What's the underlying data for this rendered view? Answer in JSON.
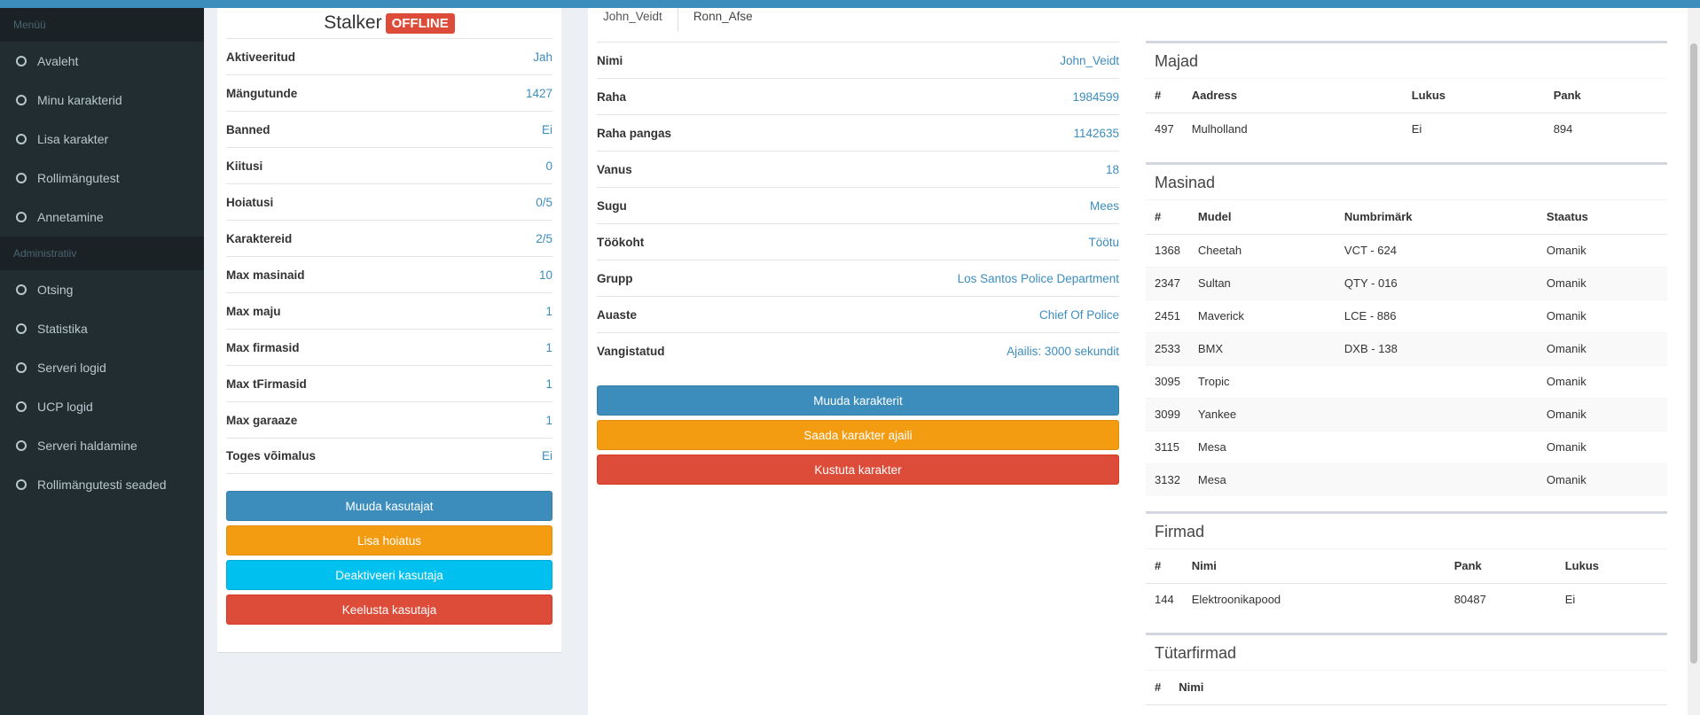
{
  "sidebar": {
    "header1": "Menüü",
    "items1": [
      {
        "label": "Avaleht"
      },
      {
        "label": "Minu karakterid"
      },
      {
        "label": "Lisa karakter"
      },
      {
        "label": "Rollimängutest"
      },
      {
        "label": "Annetamine"
      }
    ],
    "header2": "Administratiiv",
    "items2": [
      {
        "label": "Otsing"
      },
      {
        "label": "Statistika"
      },
      {
        "label": "Serveri logid"
      },
      {
        "label": "UCP logid"
      },
      {
        "label": "Serveri haldamine"
      },
      {
        "label": "Rollimängutesti seaded"
      }
    ]
  },
  "user": {
    "name": "Stalker",
    "status": "OFFLINE",
    "status_color": "#dd4b39",
    "fields": [
      {
        "label": "Aktiveeritud",
        "value": "Jah"
      },
      {
        "label": "Mängutunde",
        "value": "1427"
      },
      {
        "label": "Banned",
        "value": "Ei"
      },
      {
        "label": "Kiitusi",
        "value": "0"
      },
      {
        "label": "Hoiatusi",
        "value": "0/5"
      },
      {
        "label": "Karaktereid",
        "value": "2/5"
      },
      {
        "label": "Max masinaid",
        "value": "10"
      },
      {
        "label": "Max maju",
        "value": "1"
      },
      {
        "label": "Max firmasid",
        "value": "1"
      },
      {
        "label": "Max tFirmasid",
        "value": "1"
      },
      {
        "label": "Max garaaze",
        "value": "1"
      },
      {
        "label": "Toges võimalus",
        "value": "Ei"
      }
    ],
    "buttons": {
      "edit": "Muuda kasutajat",
      "warn": "Lisa hoiatus",
      "deactivate": "Deaktiveeri kasutaja",
      "ban": "Keelusta kasutaja"
    }
  },
  "character": {
    "tabs": [
      "John_Veidt",
      "Ronn_Afse"
    ],
    "fields": [
      {
        "label": "Nimi",
        "value": "John_Veidt"
      },
      {
        "label": "Raha",
        "value": "1984599"
      },
      {
        "label": "Raha pangas",
        "value": "1142635"
      },
      {
        "label": "Vanus",
        "value": "18"
      },
      {
        "label": "Sugu",
        "value": "Mees"
      },
      {
        "label": "Töökoht",
        "value": "Töötu"
      },
      {
        "label": "Grupp",
        "value": "Los Santos Police Department"
      },
      {
        "label": "Auaste",
        "value": "Chief Of Police"
      },
      {
        "label": "Vangistatud",
        "value": "Ajailis: 3000 sekundit"
      }
    ],
    "buttons": {
      "edit": "Muuda karakterit",
      "jail": "Saada karakter ajaili",
      "delete": "Kustuta karakter"
    }
  },
  "houses": {
    "title": "Majad",
    "headers": [
      "#",
      "Aadress",
      "Lukus",
      "Pank"
    ],
    "rows": [
      [
        "497",
        "Mulholland",
        "Ei",
        "894"
      ]
    ]
  },
  "vehicles": {
    "title": "Masinad",
    "headers": [
      "#",
      "Mudel",
      "Numbrimärk",
      "Staatus"
    ],
    "rows": [
      [
        "1368",
        "Cheetah",
        "VCT - 624",
        "Omanik"
      ],
      [
        "2347",
        "Sultan",
        "QTY - 016",
        "Omanik"
      ],
      [
        "2451",
        "Maverick",
        "LCE - 886",
        "Omanik"
      ],
      [
        "2533",
        "BMX",
        "DXB - 138",
        "Omanik"
      ],
      [
        "3095",
        "Tropic",
        "",
        "Omanik"
      ],
      [
        "3099",
        "Yankee",
        "",
        "Omanik"
      ],
      [
        "3115",
        "Mesa",
        "",
        "Omanik"
      ],
      [
        "3132",
        "Mesa",
        "",
        "Omanik"
      ]
    ]
  },
  "businesses": {
    "title": "Firmad",
    "headers": [
      "#",
      "Nimi",
      "Pank",
      "Lukus"
    ],
    "rows": [
      [
        "144",
        "Elektroonikapood",
        "80487",
        "Ei"
      ]
    ]
  },
  "subsidiaries": {
    "title": "Tütarfirmad",
    "headers": [
      "#",
      "Nimi"
    ]
  }
}
